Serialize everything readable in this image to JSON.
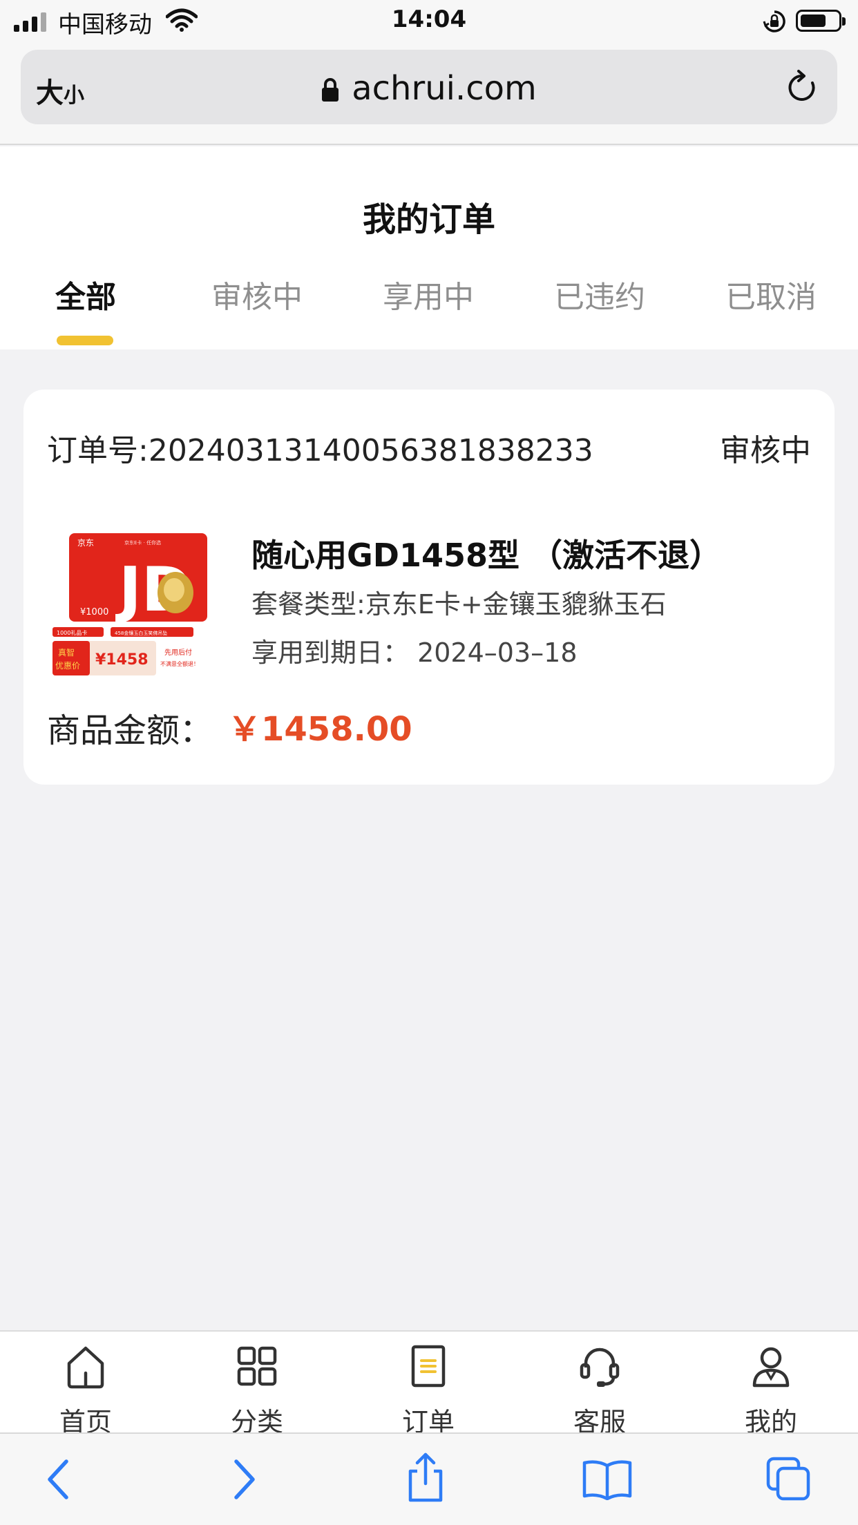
{
  "status_bar": {
    "carrier": "中国移动",
    "time": "14:04",
    "signal_bars": 4,
    "battery_level": 0.7
  },
  "browser": {
    "text_size_label_big": "大",
    "text_size_label_small": "小",
    "url": "achrui.com"
  },
  "page": {
    "title": "我的订单",
    "tabs": [
      {
        "label": "全部",
        "active": true
      },
      {
        "label": "审核中",
        "active": false
      },
      {
        "label": "享用中",
        "active": false
      },
      {
        "label": "已违约",
        "active": false
      },
      {
        "label": "已取消",
        "active": false
      }
    ],
    "accent_color": "#f1c232"
  },
  "order": {
    "order_number": "订单号:20240313140056381838233",
    "status": "审核中",
    "product_name": "随心用GD1458型 （激活不退）",
    "package_type": "套餐类型:京东E卡+金镶玉貔貅玉石",
    "expiry": "享用到期日：  2024–03–18",
    "amount_label": "商品金额：",
    "amount_value": "￥1458.00",
    "price_color": "#e54d26",
    "thumbnail": {
      "brand": "京东",
      "big_mark": "JD",
      "card_value": "¥1000",
      "tag_left": "1000礼品卡",
      "tag_right": "458金镶玉白玉笑佛吊坠",
      "promo_label_1": "真智",
      "promo_label_2": "优惠价",
      "promo_price": "¥1458",
      "promo_note_1": "先用后付",
      "promo_note_2": "不满意全额退！",
      "card_header": "京东E卡 · 任你选"
    }
  },
  "app_tabbar": [
    {
      "label": "首页",
      "icon": "home-icon"
    },
    {
      "label": "分类",
      "icon": "grid-icon"
    },
    {
      "label": "订单",
      "icon": "order-list-icon"
    },
    {
      "label": "客服",
      "icon": "headset-icon"
    },
    {
      "label": "我的",
      "icon": "user-icon"
    }
  ],
  "safari_toolbar": [
    {
      "icon": "back-icon"
    },
    {
      "icon": "forward-icon"
    },
    {
      "icon": "share-icon"
    },
    {
      "icon": "bookmarks-icon"
    },
    {
      "icon": "tabs-icon"
    }
  ]
}
